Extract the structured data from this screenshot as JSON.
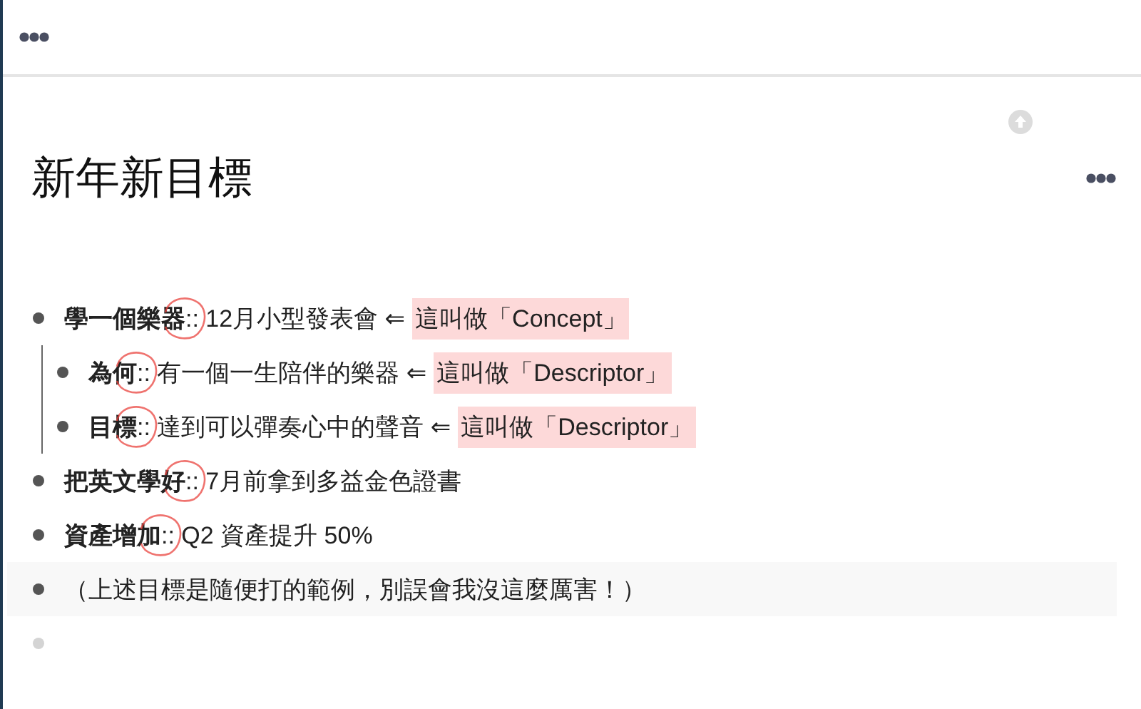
{
  "title": "新年新目標",
  "items": [
    {
      "kind": "property",
      "text": "**學一個樂器**:: 12月小型發表會 ⇐",
      "tag": "這叫做「Concept」",
      "annotated": true,
      "highlighted": false,
      "children": [
        {
          "kind": "property",
          "text": "**為何**:: 有一個一生陪伴的樂器 ⇐",
          "tag": "這叫做「Descriptor」",
          "annotated": true,
          "highlighted": false
        },
        {
          "kind": "property",
          "text": "**目標**:: 達到可以彈奏心中的聲音 ⇐",
          "tag": "這叫做「Descriptor」",
          "annotated": true,
          "highlighted": false
        }
      ]
    },
    {
      "kind": "property",
      "text": "**把英文學好**:: 7月前拿到多益金色證書",
      "annotated": true,
      "highlighted": false
    },
    {
      "kind": "property",
      "text": "**資產增加**:: Q2 資產提升 50%",
      "annotated": true,
      "highlighted": false
    },
    {
      "kind": "text",
      "text": "（上述目標是隨便打的範例，別誤會我沒這麼厲害！）",
      "annotated": false,
      "highlighted": true
    },
    {
      "kind": "empty"
    }
  ]
}
